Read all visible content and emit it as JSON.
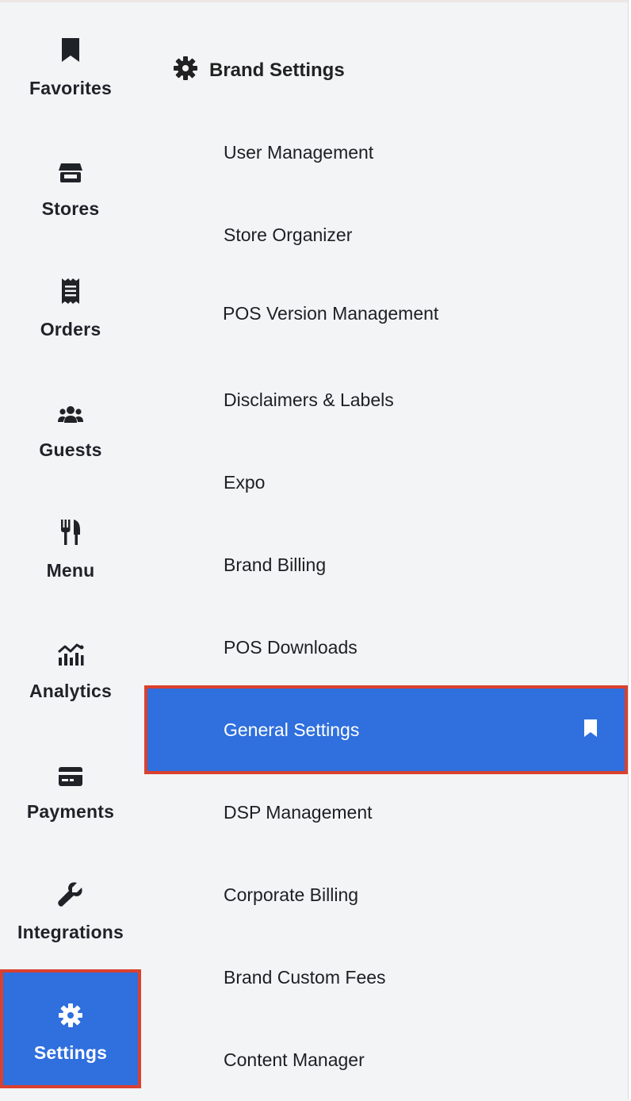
{
  "rail": {
    "items": [
      {
        "label": "Favorites",
        "icon": "bookmark-icon"
      },
      {
        "label": "Stores",
        "icon": "store-icon"
      },
      {
        "label": "Orders",
        "icon": "receipt-icon"
      },
      {
        "label": "Guests",
        "icon": "users-icon"
      },
      {
        "label": "Menu",
        "icon": "utensils-icon"
      },
      {
        "label": "Analytics",
        "icon": "chart-icon"
      },
      {
        "label": "Payments",
        "icon": "credit-card-icon"
      },
      {
        "label": "Integrations",
        "icon": "wrench-icon"
      },
      {
        "label": "Settings",
        "icon": "gear-icon",
        "active": true
      }
    ]
  },
  "submenu": {
    "title": "Brand Settings",
    "title_icon": "gear-icon",
    "items": [
      {
        "label": "User Management"
      },
      {
        "label": "Store Organizer"
      },
      {
        "label": "POS Version Management"
      },
      {
        "label": "Disclaimers & Labels"
      },
      {
        "label": "Expo"
      },
      {
        "label": "Brand Billing"
      },
      {
        "label": "POS Downloads"
      },
      {
        "label": "General Settings",
        "active": true,
        "icon": "bookmark-icon"
      },
      {
        "label": "DSP Management"
      },
      {
        "label": "Corporate Billing"
      },
      {
        "label": "Brand Custom Fees"
      },
      {
        "label": "Content Manager"
      }
    ]
  },
  "colors": {
    "background": "#f3f4f6",
    "accent": "#2f6fde",
    "highlight_border": "#d9412f",
    "text": "#1f2328"
  }
}
